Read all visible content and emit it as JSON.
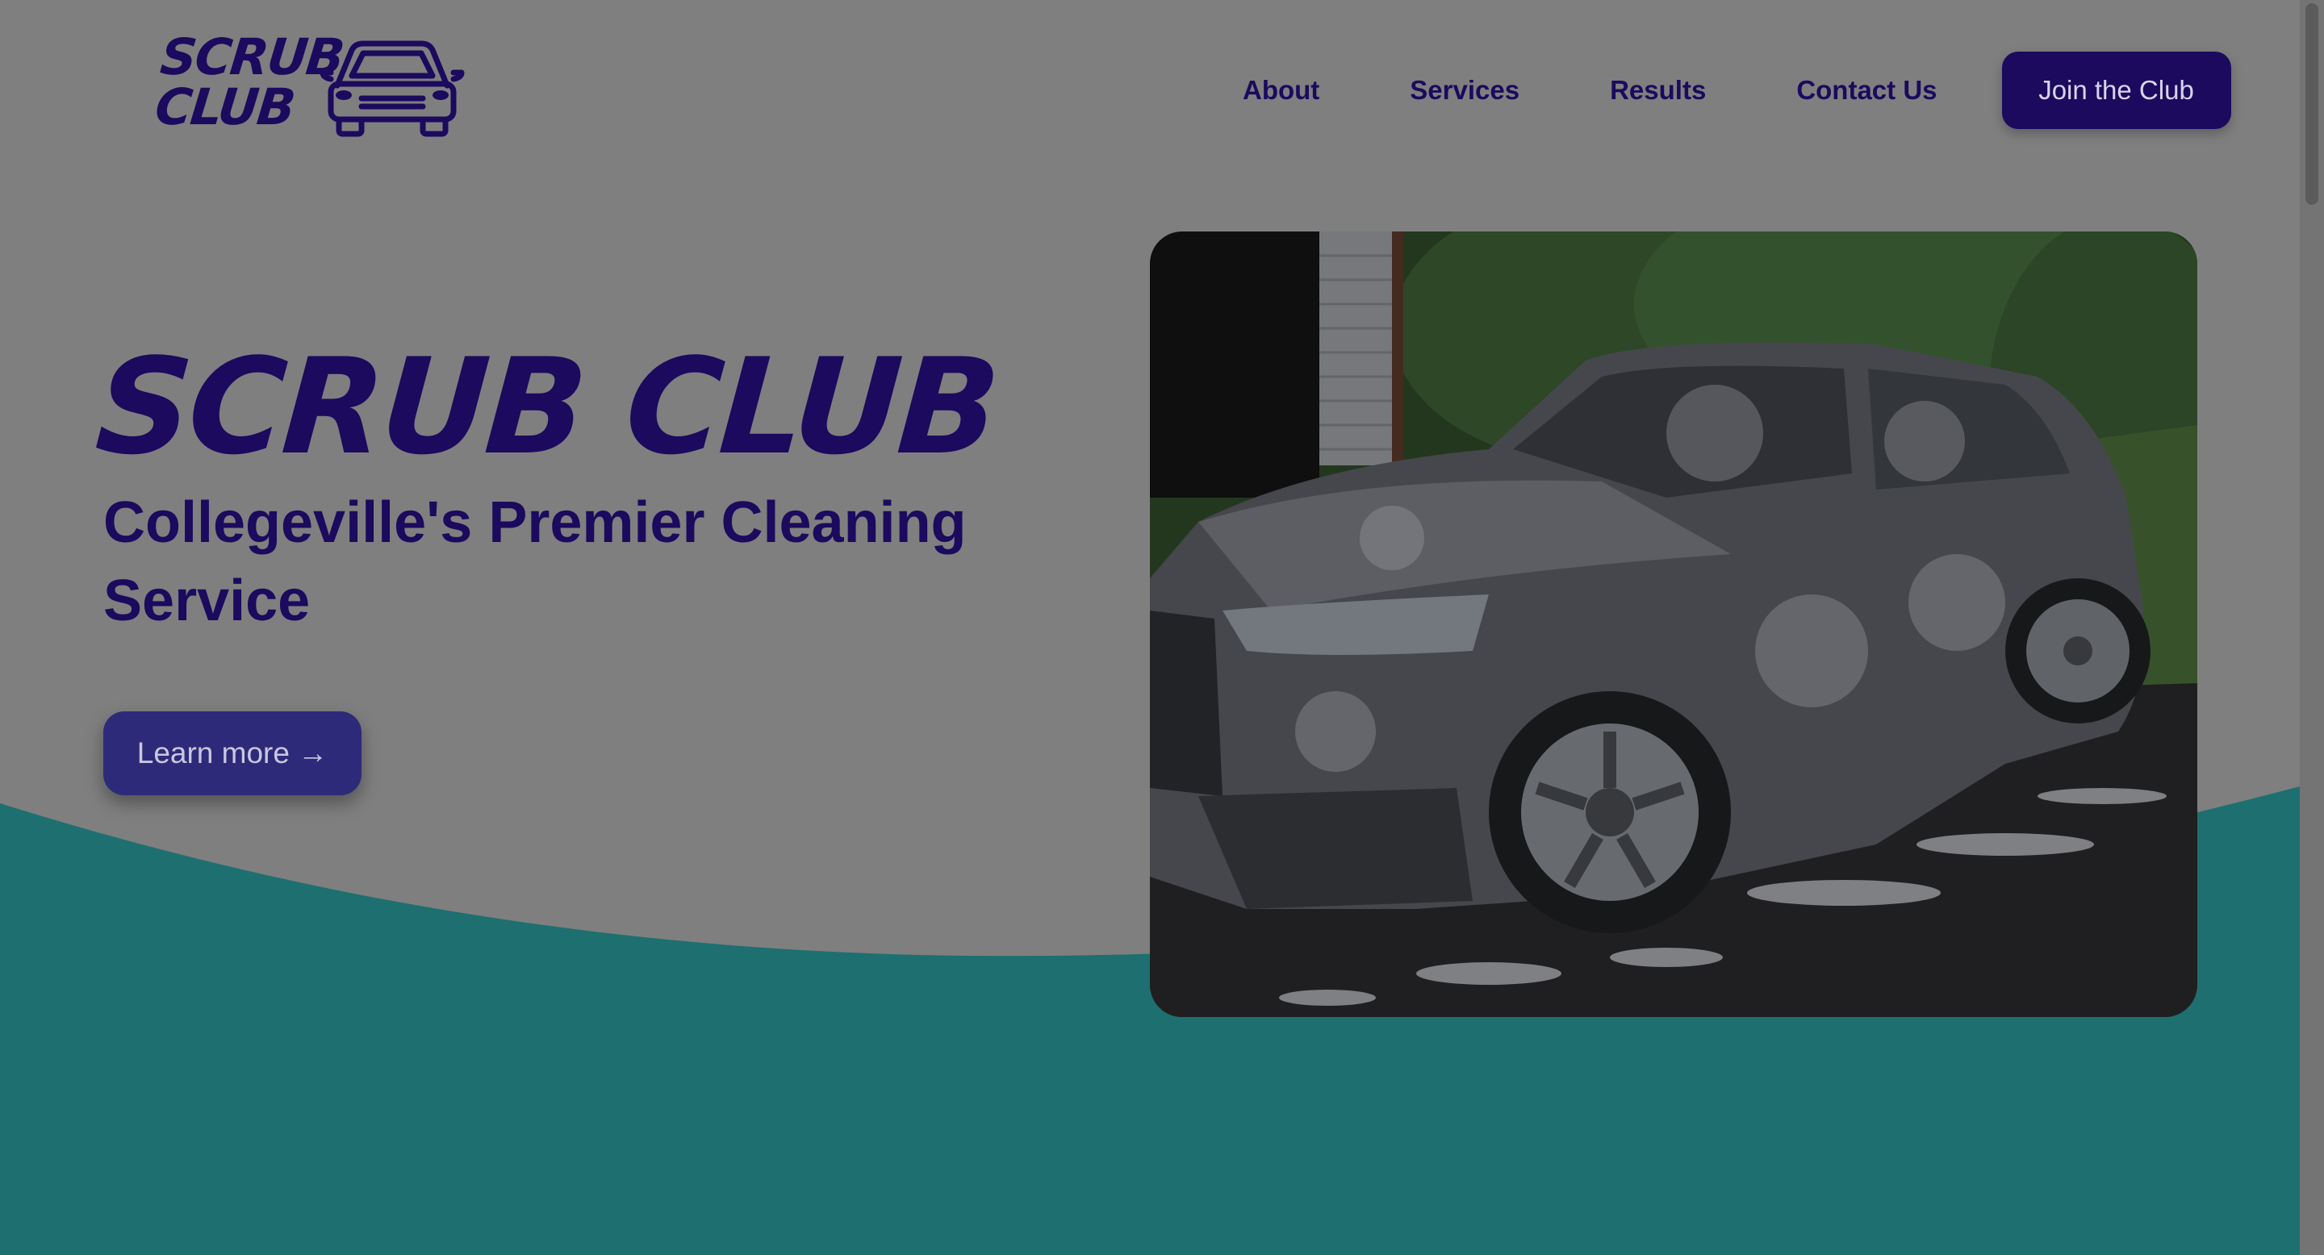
{
  "colors": {
    "page_background": "#7f7f7f",
    "brand_navy": "#1b0a5e",
    "teal": "#1e6f70",
    "button_secondary": "#2e2a7a"
  },
  "header": {
    "logo": {
      "line1": "SCRUB",
      "line2": "CLUB",
      "icon": "car-icon"
    },
    "nav": [
      {
        "label": "About"
      },
      {
        "label": "Services"
      },
      {
        "label": "Results"
      },
      {
        "label": "Contact Us"
      }
    ],
    "cta_label": "Join the Club"
  },
  "hero": {
    "title": "SCRUB CLUB",
    "subtitle": "Collegeville's Premier Cleaning Service",
    "button_label": "Learn more →",
    "image_subject": "foam-covered-suv-photo"
  }
}
